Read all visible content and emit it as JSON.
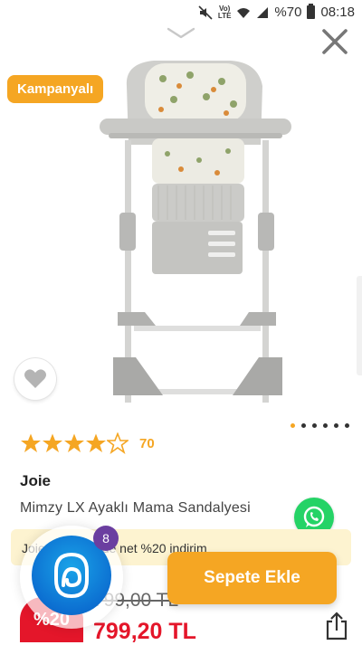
{
  "status_bar": {
    "battery": "%70",
    "time": "08:18",
    "network": "VoLTE"
  },
  "campaign_badge": "Kampanyalı",
  "gallery": {
    "images": 6,
    "active": 1
  },
  "rating": {
    "stars": 4,
    "max": 5,
    "count": "70"
  },
  "product": {
    "brand": "Joie",
    "name": "Mimzy LX Ayaklı Mama Sandalyesi"
  },
  "promo": {
    "text": "Joie ... ürünlerde net %20 indirim"
  },
  "price": {
    "old": "799,00 TL",
    "new": "799,20 TL",
    "discount": "%20"
  },
  "assistant": {
    "notification_count": "8"
  },
  "cart": {
    "button_label": "Sepete Ekle"
  },
  "colors": {
    "accent": "#f5a623",
    "price_red": "#e4162a",
    "whatsapp": "#25d366",
    "promo_bg": "#fdf3d0"
  }
}
